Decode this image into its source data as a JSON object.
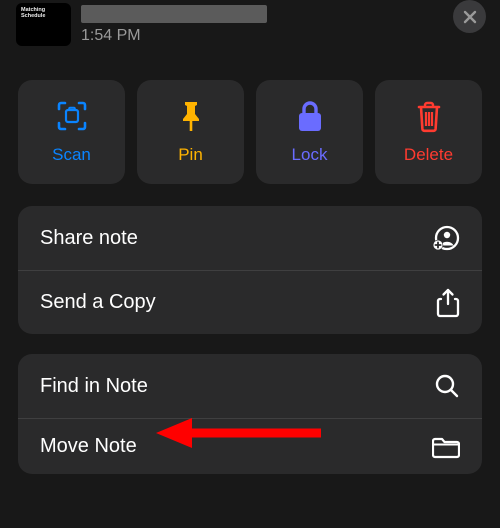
{
  "header": {
    "thumb_line1": "Matching Schedule",
    "timestamp": "1:54 PM"
  },
  "actions": {
    "scan": {
      "label": "Scan",
      "icon": "scan-icon",
      "color": "#0a84ff"
    },
    "pin": {
      "label": "Pin",
      "icon": "pin-icon",
      "color": "#ffb300"
    },
    "lock": {
      "label": "Lock",
      "icon": "lock-icon",
      "color": "#6a6cff"
    },
    "delete": {
      "label": "Delete",
      "icon": "trash-icon",
      "color": "#ff3b30"
    }
  },
  "list1": {
    "share": {
      "label": "Share note",
      "icon": "person-add-icon"
    },
    "send_copy": {
      "label": "Send a Copy",
      "icon": "share-up-icon"
    }
  },
  "list2": {
    "find": {
      "label": "Find in Note",
      "icon": "search-icon"
    },
    "move": {
      "label": "Move Note",
      "icon": "folder-icon"
    }
  },
  "annotation": {
    "points_to": "find-in-note-item"
  }
}
